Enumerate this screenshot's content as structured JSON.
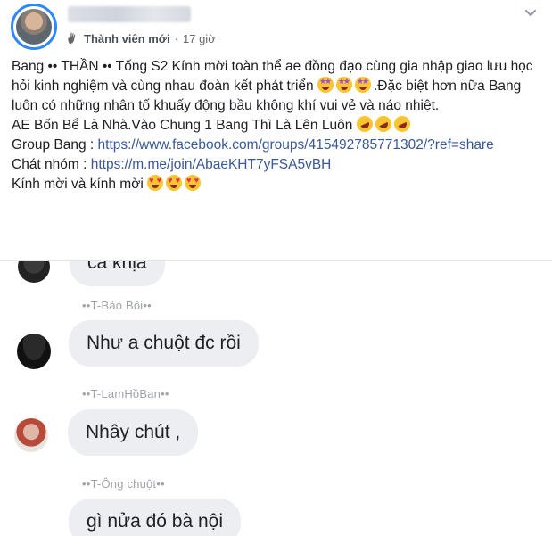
{
  "post": {
    "badge": "Thành viên mới",
    "separator": "·",
    "time": "17 giờ",
    "line1": "Bang •• THẦN •• Tống S2 Kính mời toàn thể ae đồng đạo cùng gia nhập giao lưu học hỏi kinh nghiệm và cùng nhau đoàn kết phát triển",
    "line1_tail": ".Đặc biệt hơn nữa Bang luôn có những nhân tố khuấy động bầu không khí vui vẻ và náo nhiệt.",
    "line2": "AE Bốn Bể Là Nhà.Vào Chung 1 Bang Thì Là Lên Luôn",
    "group_label": "Group Bang : ",
    "group_url": "https://www.facebook.com/groups/415492785771302/?ref=share",
    "chat_label": "Chát nhóm : ",
    "chat_url": "https://m.me/join/AbaeKHT7yFSA5vBH",
    "closing": "Kính mời và kính mời",
    "icons": {
      "member": "waving-hand-icon",
      "menu": "chevron-down-icon"
    }
  },
  "chat": {
    "partial_message": "cả khịa",
    "messages": [
      {
        "sender": "••T-Bảo Bối••",
        "text": "Như a chuột đc rồi"
      },
      {
        "sender": "••T-LamHồBan••",
        "text": "Nhây chút ,"
      },
      {
        "sender": "••T-Ông chuột••",
        "text": "gì nửa đó bà nội"
      }
    ]
  },
  "colors": {
    "link": "#385898",
    "accent": "#2d88ff",
    "bubble": "#eceef1"
  }
}
